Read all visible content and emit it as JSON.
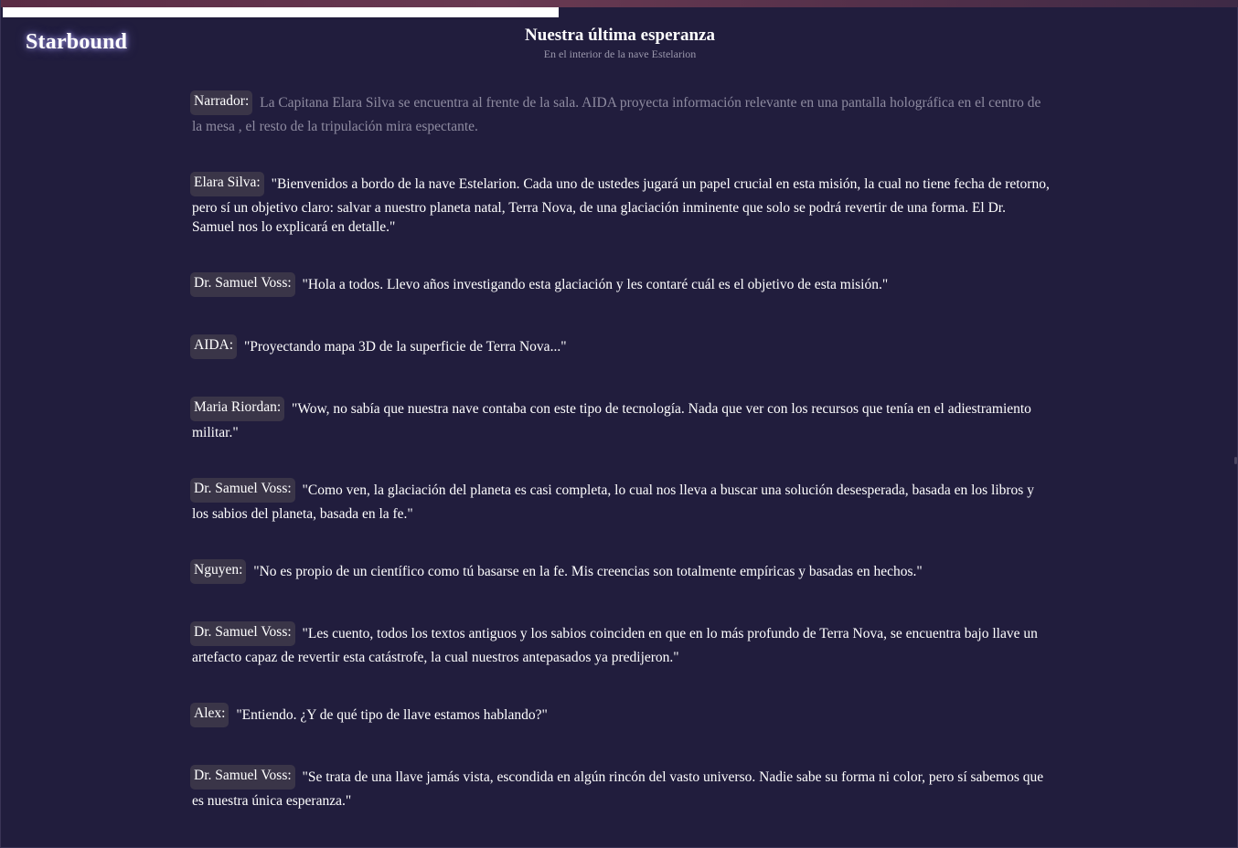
{
  "app": {
    "logo": "Starbound"
  },
  "progress": {
    "fraction": 0.45
  },
  "scene": {
    "title": "Nuestra última esperanza",
    "subtitle": "En el interior de la nave Estelarion"
  },
  "dialogue": [
    {
      "speaker": "Narrador:",
      "text": "La Capitana Elara Silva se encuentra al frente de la sala. AIDA proyecta información relevante en una pantalla holográfica en el centro de la mesa , el resto de la tripulación mira espectante.",
      "narrator": true
    },
    {
      "speaker": "Elara Silva:",
      "text": "\"Bienvenidos a bordo de la nave Estelarion. Cada uno de ustedes jugará un papel crucial en esta misión, la cual no tiene fecha de retorno, pero sí un objetivo claro: salvar a nuestro planeta natal, Terra Nova, de una glaciación inminente que solo se podrá revertir de una forma. El Dr. Samuel nos lo explicará en detalle.\""
    },
    {
      "speaker": "Dr. Samuel Voss:",
      "text": "\"Hola a todos. Llevo años investigando esta glaciación y les contaré cuál es el objetivo de esta misión.\""
    },
    {
      "speaker": "AIDA:",
      "text": "\"Proyectando mapa 3D de la superficie de Terra Nova...\""
    },
    {
      "speaker": "Maria Riordan:",
      "text": "\"Wow, no sabía que nuestra nave contaba con este tipo de tecnología. Nada que ver con los recursos que tenía en el adiestramiento militar.\""
    },
    {
      "speaker": "Dr. Samuel Voss:",
      "text": "\"Como ven, la glaciación del planeta es casi completa, lo cual nos lleva a buscar una solución desesperada, basada en los libros y los sabios del planeta, basada en la fe.\""
    },
    {
      "speaker": "Nguyen:",
      "text": "\"No es propio de un científico como tú basarse en la fe. Mis creencias son totalmente empíricas y basadas en hechos.\""
    },
    {
      "speaker": "Dr. Samuel Voss:",
      "text": "\"Les cuento, todos los textos antiguos y los sabios coinciden en que en lo más profundo de Terra Nova, se encuentra bajo llave un artefacto capaz de revertir esta catástrofe, la cual nuestros antepasados ya predijeron.\""
    },
    {
      "speaker": "Alex:",
      "text": "\"Entiendo. ¿Y de qué tipo de llave estamos hablando?\""
    },
    {
      "speaker": "Dr. Samuel Voss:",
      "text": "\"Se trata de una llave jamás vista, escondida en algún rincón del vasto universo. Nadie sabe su forma ni color, pero sí sabemos que es nuestra única esperanza.\""
    }
  ]
}
